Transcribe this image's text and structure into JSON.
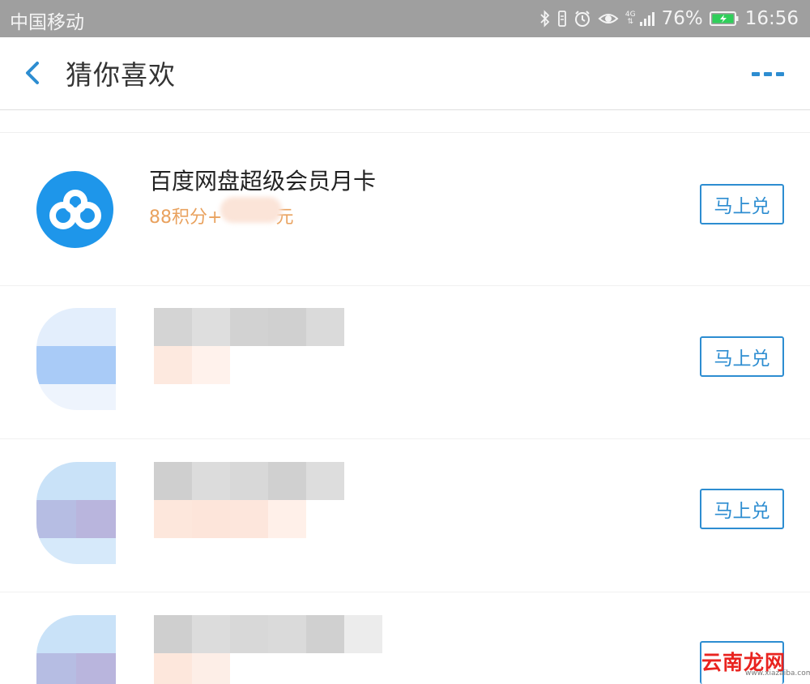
{
  "status_bar": {
    "carrier": "中国移动",
    "network": "4G",
    "battery": "76%",
    "time": "16:56"
  },
  "header": {
    "title": "猜你喜欢",
    "back_icon": "chevron-left-icon",
    "more_icon": "more-icon"
  },
  "items": [
    {
      "title": "百度网盘超级会员月卡",
      "price": "88积分+",
      "price_suffix": "元",
      "button": "马上兑",
      "icon": "baidu-netdisk-icon"
    },
    {
      "button": "马上兑"
    },
    {
      "button": "马上兑"
    },
    {
      "button": "马上兑"
    }
  ],
  "watermark": {
    "text": "云南龙网",
    "sub": "www.xiazaiba.com"
  },
  "colors": {
    "accent": "#2d8dd1",
    "price": "#e9a25f",
    "status_bar": "#9f9f9f"
  }
}
